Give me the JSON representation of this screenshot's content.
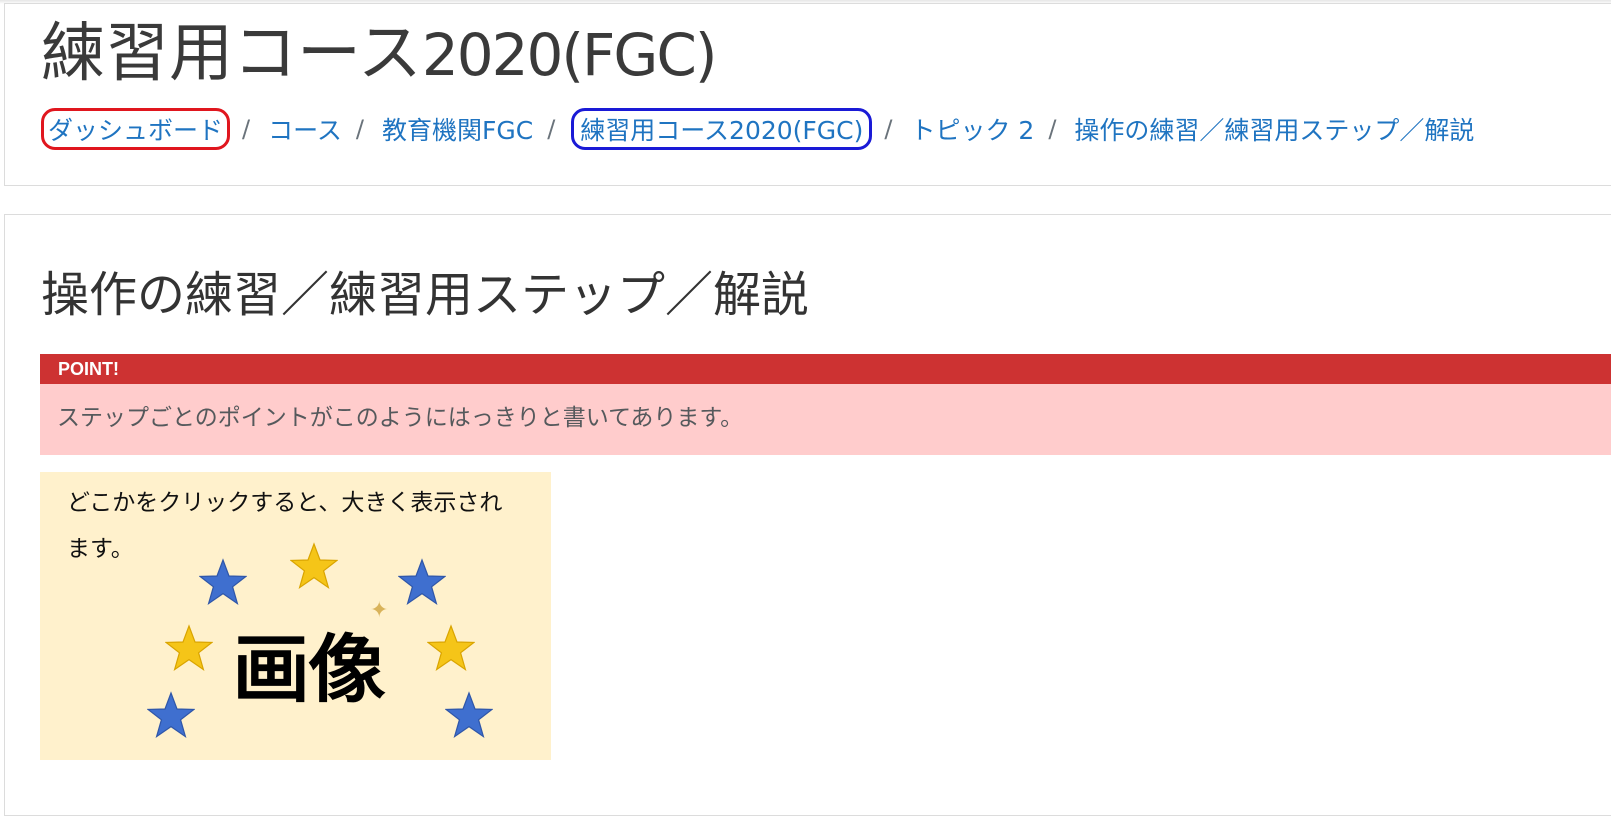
{
  "header": {
    "course_title_jp": "練習用コース",
    "course_title_latin": "2020(FGC)"
  },
  "breadcrumb": {
    "items": [
      {
        "label": "ダッシュボード"
      },
      {
        "label": "コース"
      },
      {
        "label": "教育機関FGC"
      },
      {
        "label": "練習用コース2020(FGC)"
      },
      {
        "label": "トピック 2"
      },
      {
        "label": "操作の練習／練習用ステップ／解説"
      }
    ],
    "separator": "/"
  },
  "main": {
    "page_heading": "操作の練習／練習用ステップ／解説",
    "point": {
      "label": "POINT!",
      "text": "ステップごとのポイントがこのようにはっきりと書いてあります。"
    },
    "image_card": {
      "caption": "どこかをクリックすると、大きく表示されます。",
      "word": "画像"
    }
  },
  "colors": {
    "link": "#1f74c1",
    "point_header": "#cd3232",
    "point_body": "#ffcccc",
    "image_bg": "#fff1cc",
    "highlight_red": "#e0161e",
    "highlight_blue": "#1a1ad6",
    "star_blue": "#3f6fcf",
    "star_gold": "#f5c518"
  }
}
